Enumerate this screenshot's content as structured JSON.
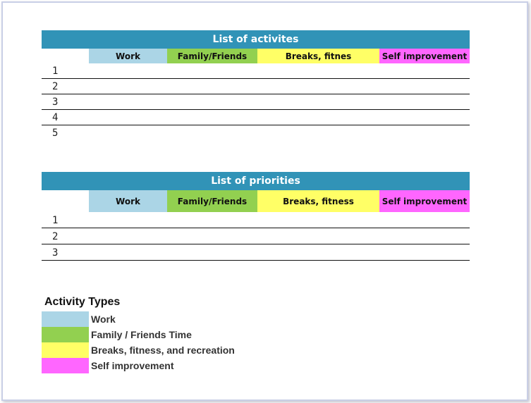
{
  "colors": {
    "title_bar": "#3193b7",
    "work": "#abd5e6",
    "family": "#92d050",
    "breaks": "#ffff66",
    "self": "#ff66ff"
  },
  "activities": {
    "title": "List of activites",
    "headers": [
      "Work",
      "Family/Friends",
      "Breaks, fitnes",
      "Self improvement"
    ],
    "rows": [
      "1",
      "2",
      "3",
      "4",
      "5"
    ]
  },
  "priorities": {
    "title": "List of priorities",
    "headers": [
      "Work",
      "Family/Friends",
      "Breaks, fitness",
      "Self improvement"
    ],
    "rows": [
      "1",
      "2",
      "3"
    ]
  },
  "legend": {
    "title": "Activity Types",
    "items": [
      {
        "label": "Work",
        "color": "#abd5e6"
      },
      {
        "label": "Family / Friends Time",
        "color": "#92d050"
      },
      {
        "label": "Breaks, fitness, and recreation",
        "color": "#ffff66"
      },
      {
        "label": "Self improvement",
        "color": "#ff66ff"
      }
    ]
  }
}
